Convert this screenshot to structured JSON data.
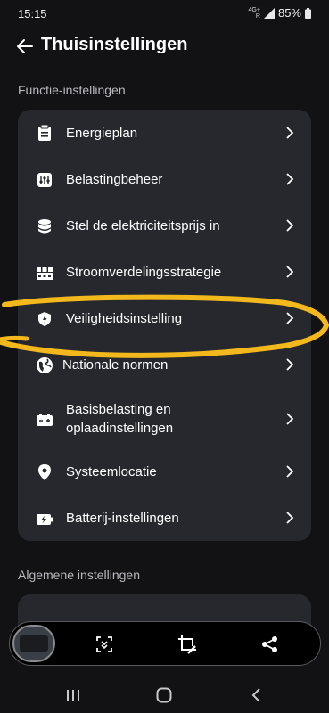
{
  "status": {
    "time": "15:15",
    "network_top": "4G+",
    "network_bottom": "R",
    "battery": "85%"
  },
  "header": {
    "title": "Thuisinstellingen"
  },
  "sections": {
    "function_label": "Functie-instellingen",
    "general_label": "Algemene instellingen"
  },
  "items": [
    {
      "label": "Energieplan",
      "icon": "clipboard-icon"
    },
    {
      "label": "Belastingbeheer",
      "icon": "load-control-icon"
    },
    {
      "label": "Stel de elektriciteitsprijs in",
      "icon": "database-icon"
    },
    {
      "label": "Stroomverdelingsstrategie",
      "icon": "grid-icon"
    },
    {
      "label": "Veiligheidsinstelling",
      "icon": "shield-icon"
    },
    {
      "label": "Nationale normen",
      "icon": "globe-icon"
    },
    {
      "label": "Basisbelasting en oplaadinstellingen",
      "icon": "battery-charge-icon"
    },
    {
      "label": "Systeemlocatie",
      "icon": "location-pin-icon"
    },
    {
      "label": "Batterij-instellingen",
      "icon": "battery-icon"
    }
  ],
  "colors": {
    "background": "#121215",
    "card": "#26282e",
    "highlight": "#f2b81c"
  }
}
